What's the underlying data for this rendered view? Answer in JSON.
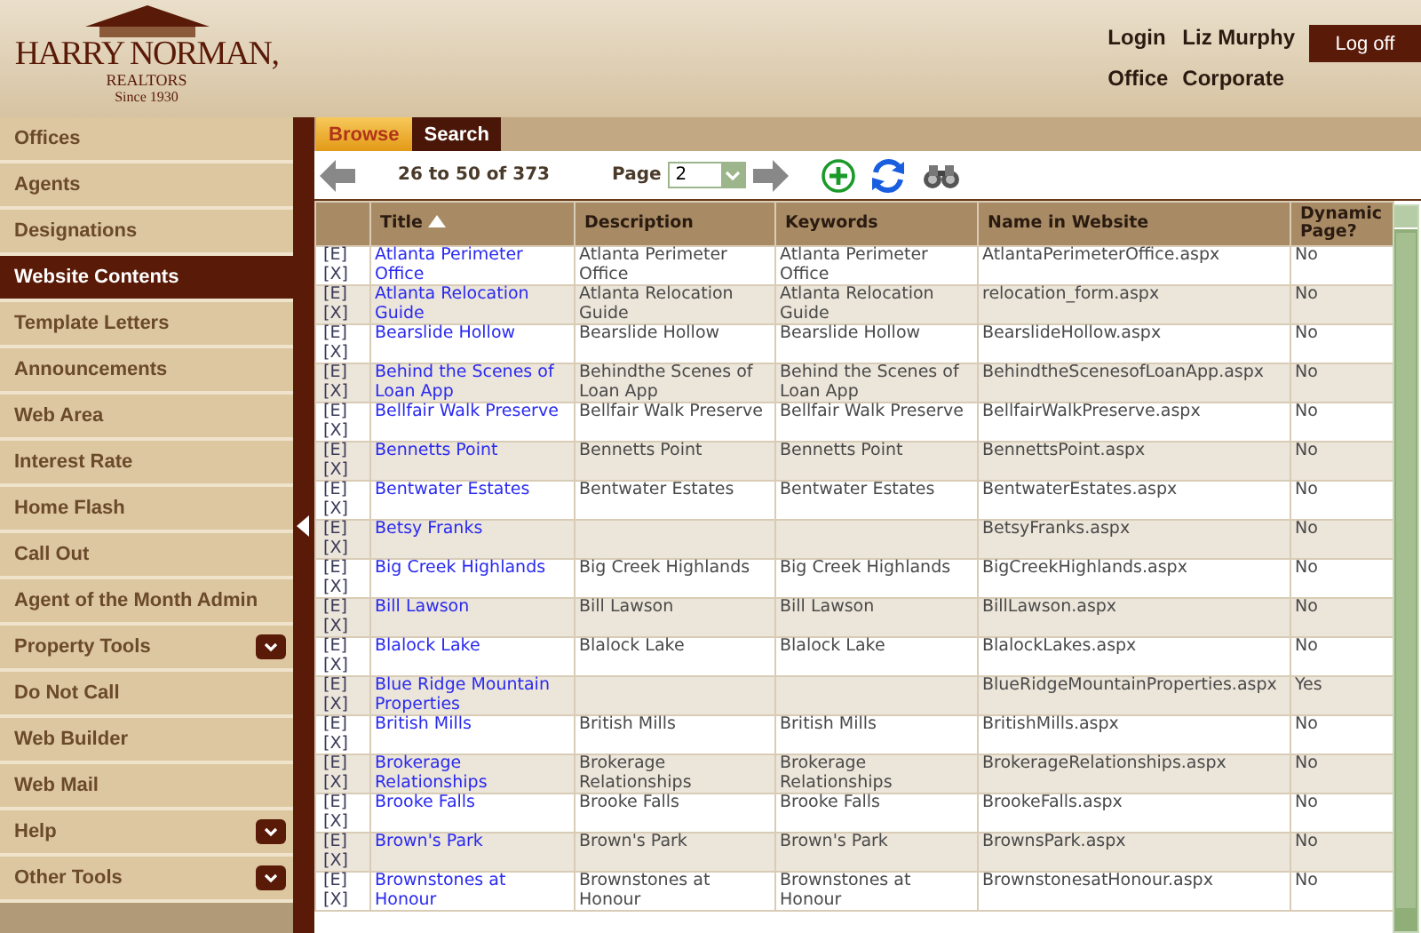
{
  "header": {
    "logo": {
      "name": "HARRY NORMAN,",
      "subtitle": "REALTORS",
      "since": "Since 1930"
    },
    "user": [
      {
        "label": "Login",
        "value": "Liz Murphy"
      },
      {
        "label": "Office",
        "value": "Corporate"
      }
    ],
    "logoff_button": "Log off"
  },
  "sidebar": {
    "items": [
      {
        "label": "Offices",
        "selected": false,
        "expandable": false
      },
      {
        "label": "Agents",
        "selected": false,
        "expandable": false
      },
      {
        "label": "Designations",
        "selected": false,
        "expandable": false
      },
      {
        "label": "Website Contents",
        "selected": true,
        "expandable": false
      },
      {
        "label": "Template Letters",
        "selected": false,
        "expandable": false
      },
      {
        "label": "Announcements",
        "selected": false,
        "expandable": false
      },
      {
        "label": "Web Area",
        "selected": false,
        "expandable": false
      },
      {
        "label": "Interest Rate",
        "selected": false,
        "expandable": false
      },
      {
        "label": "Home Flash",
        "selected": false,
        "expandable": false
      },
      {
        "label": "Call Out",
        "selected": false,
        "expandable": false
      },
      {
        "label": "Agent of the Month Admin",
        "selected": false,
        "expandable": false
      },
      {
        "label": "Property Tools",
        "selected": false,
        "expandable": true
      },
      {
        "label": "Do Not Call",
        "selected": false,
        "expandable": false
      },
      {
        "label": "Web Builder",
        "selected": false,
        "expandable": false
      },
      {
        "label": "Web Mail",
        "selected": false,
        "expandable": false
      },
      {
        "label": "Help",
        "selected": false,
        "expandable": true
      },
      {
        "label": "Other Tools",
        "selected": false,
        "expandable": true
      }
    ]
  },
  "tabs": [
    {
      "label": "Browse",
      "selected": true
    },
    {
      "label": "Search",
      "selected": false
    }
  ],
  "toolbar": {
    "range": "26 to 50 of 373",
    "page_label": "Page",
    "page_value": "2"
  },
  "table": {
    "columns": [
      {
        "sorted": false
      },
      {
        "label": "Title",
        "sorted": true
      },
      {
        "label": "Description",
        "sorted": false
      },
      {
        "label": "Keywords",
        "sorted": false
      },
      {
        "label": "Name in Website",
        "sorted": false
      },
      {
        "label": "Dynamic Page?",
        "sorted": false
      }
    ],
    "rows": [
      {
        "actions": [
          "[E]",
          "[X]"
        ],
        "title": "Atlanta Perimeter Office",
        "description": "Atlanta Perimeter Office",
        "keywords": "Atlanta Perimeter Office",
        "name": "AtlantaPerimeterOffice.aspx",
        "dynamic": "No"
      },
      {
        "actions": [
          "[E]",
          "[X]"
        ],
        "title": "Atlanta Relocation Guide",
        "description": "Atlanta Relocation Guide",
        "keywords": "Atlanta Relocation Guide",
        "name": "relocation_form.aspx",
        "dynamic": "No"
      },
      {
        "actions": [
          "[E]",
          "[X]"
        ],
        "title": "Bearslide Hollow",
        "description": "Bearslide Hollow",
        "keywords": "Bearslide Hollow",
        "name": "BearslideHollow.aspx",
        "dynamic": "No"
      },
      {
        "actions": [
          "[E]",
          "[X]"
        ],
        "title": "Behind the Scenes of Loan App",
        "description": "Behindthe Scenes of Loan App",
        "keywords": "Behind the Scenes of Loan App",
        "name": "BehindtheScenesofLoanApp.aspx",
        "dynamic": "No"
      },
      {
        "actions": [
          "[E]",
          "[X]"
        ],
        "title": "Bellfair Walk Preserve",
        "description": "Bellfair Walk Preserve",
        "keywords": "Bellfair Walk Preserve",
        "name": "BellfairWalkPreserve.aspx",
        "dynamic": "No"
      },
      {
        "actions": [
          "[E]",
          "[X]"
        ],
        "title": "Bennetts Point",
        "description": "Bennetts Point",
        "keywords": "Bennetts Point",
        "name": "BennettsPoint.aspx",
        "dynamic": "No"
      },
      {
        "actions": [
          "[E]",
          "[X]"
        ],
        "title": "Bentwater Estates",
        "description": "Bentwater Estates",
        "keywords": "Bentwater Estates",
        "name": "BentwaterEstates.aspx",
        "dynamic": "No"
      },
      {
        "actions": [
          "[E]",
          "[X]"
        ],
        "title": "Betsy Franks",
        "name": "BetsyFranks.aspx",
        "dynamic": "No"
      },
      {
        "actions": [
          "[E]",
          "[X]"
        ],
        "title": "Big Creek Highlands",
        "description": "Big Creek Highlands",
        "keywords": "Big Creek Highlands",
        "name": "BigCreekHighlands.aspx",
        "dynamic": "No"
      },
      {
        "actions": [
          "[E]",
          "[X]"
        ],
        "title": "Bill Lawson",
        "description": "Bill Lawson",
        "keywords": "Bill Lawson",
        "name": "BillLawson.aspx",
        "dynamic": "No"
      },
      {
        "actions": [
          "[E]",
          "[X]"
        ],
        "title": "Blalock Lake",
        "description": "Blalock Lake",
        "keywords": "Blalock Lake",
        "name": "BlalockLakes.aspx",
        "dynamic": "No"
      },
      {
        "actions": [
          "[E]",
          "[X]"
        ],
        "title": "Blue Ridge Mountain Properties",
        "name": "BlueRidgeMountainProperties.aspx",
        "dynamic": "Yes"
      },
      {
        "actions": [
          "[E]",
          "[X]"
        ],
        "title": "British Mills",
        "description": "British Mills",
        "keywords": "British Mills",
        "name": "BritishMills.aspx",
        "dynamic": "No"
      },
      {
        "actions": [
          "[E]",
          "[X]"
        ],
        "title": "Brokerage Relationships",
        "description": "Brokerage Relationships",
        "keywords": "Brokerage Relationships",
        "name": "BrokerageRelationships.aspx",
        "dynamic": "No"
      },
      {
        "actions": [
          "[E]",
          "[X]"
        ],
        "title": "Brooke Falls",
        "description": "Brooke Falls",
        "keywords": "Brooke Falls",
        "name": "BrookeFalls.aspx",
        "dynamic": "No"
      },
      {
        "actions": [
          "[E]",
          "[X]"
        ],
        "title": "Brown's Park",
        "description": "Brown's Park",
        "keywords": "Brown's Park",
        "name": "BrownsPark.aspx",
        "dynamic": "No"
      },
      {
        "actions": [
          "[E]",
          "[X]"
        ],
        "title": "Brownstones at Honour",
        "description": "Brownstones at Honour",
        "keywords": "Brownstones at Honour",
        "name": "BrownstonesatHonour.aspx",
        "dynamic": "No"
      }
    ]
  }
}
